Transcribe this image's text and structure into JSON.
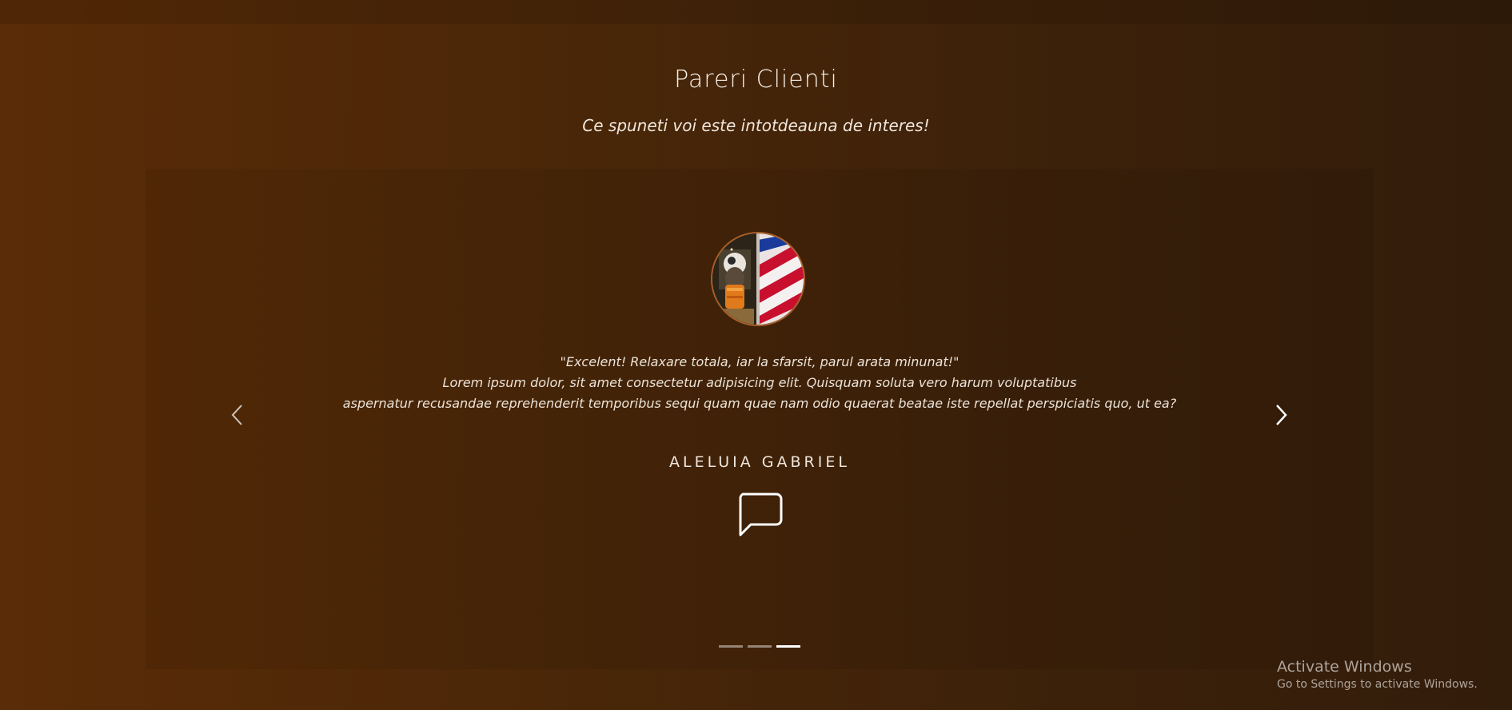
{
  "section": {
    "title": "Pareri Clienti",
    "subtitle": "Ce spuneti voi este intotdeauna de interes!"
  },
  "testimonial": {
    "quote_lines": [
      "\"Excelent! Relaxare totala, iar la sfarsit, parul arata minunat!\"",
      "Lorem ipsum dolor, sit amet consectetur adipisicing elit. Quisquam soluta vero harum voluptatibus",
      "aspernatur recusandae reprehenderit temporibus sequi quam quae nam odio quaerat beatae iste repellat perspiciatis quo, ut ea?"
    ],
    "author": "ALELUIA GABRIEL",
    "avatar_icon": "barber-avatar-image",
    "quote_icon": "chat-bubble-icon"
  },
  "carousel": {
    "prev_icon": "chevron-left-icon",
    "next_icon": "chevron-right-icon",
    "slide_count": 3,
    "active_index": 2
  },
  "os_watermark": {
    "title": "Activate Windows",
    "subtitle": "Go to Settings to activate Windows."
  },
  "colors": {
    "background_left": "#5a2c07",
    "background_right": "#321c0a",
    "avatar_border": "#a8602a",
    "text": "#f3ebe2"
  }
}
